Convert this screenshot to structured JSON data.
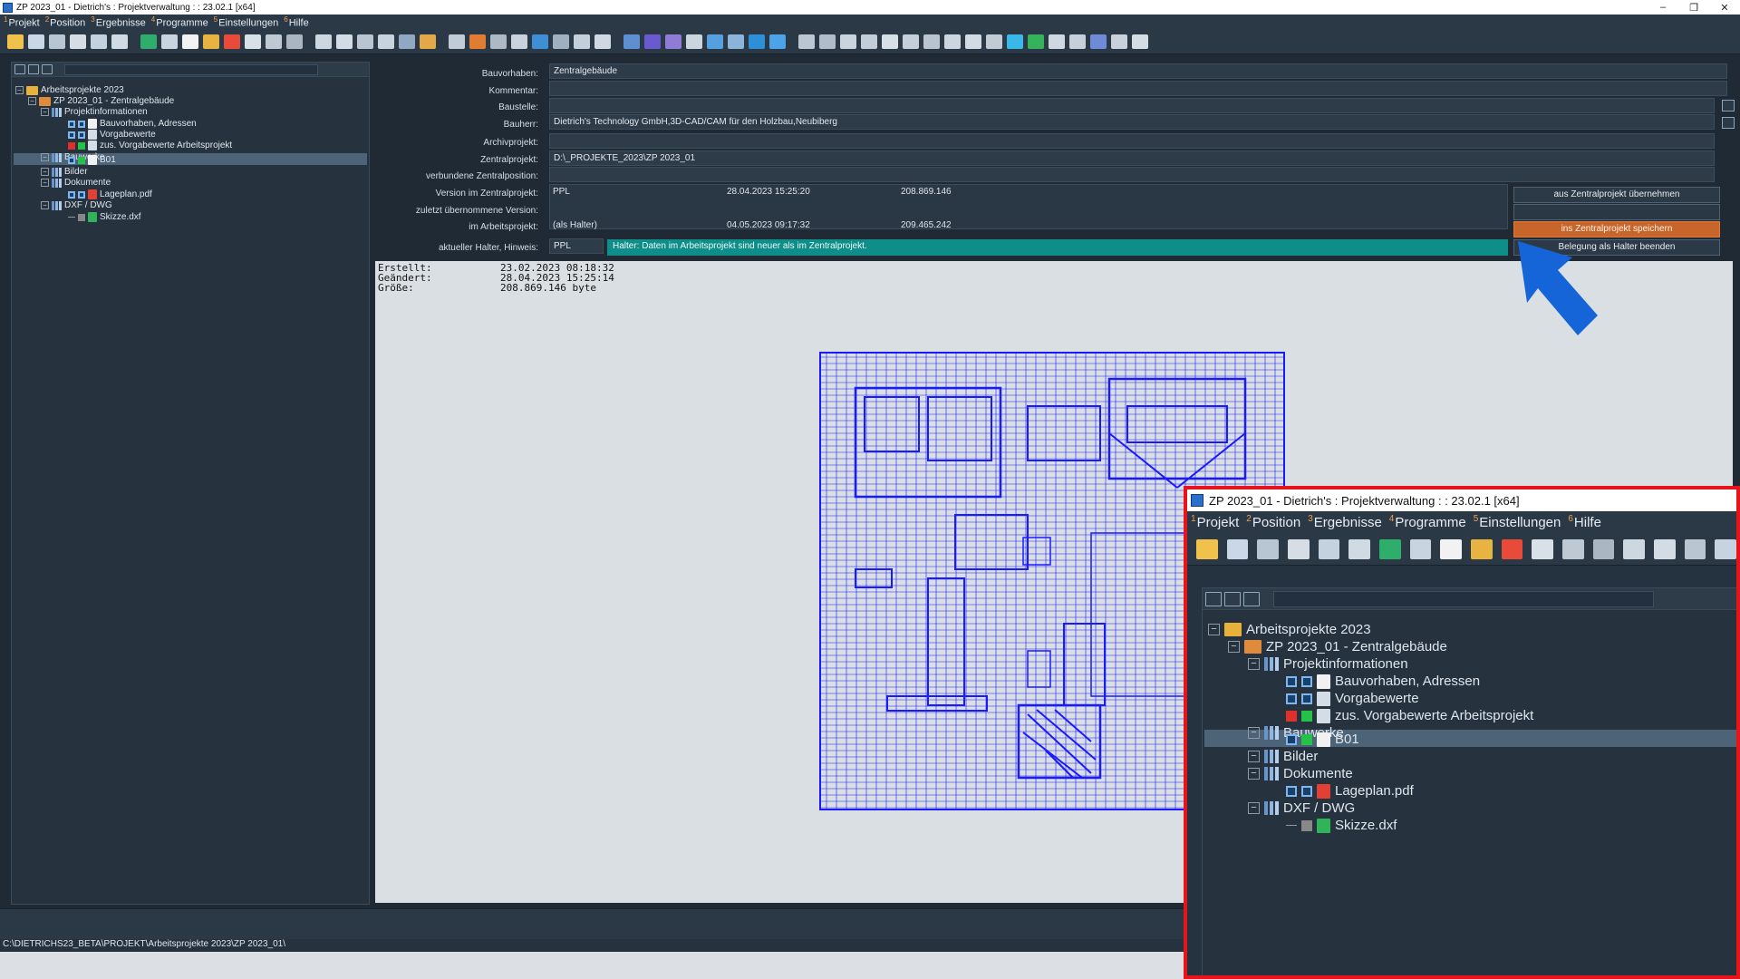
{
  "window": {
    "title": "ZP 2023_01 - Dietrich's : Projektverwaltung : : 23.02.1 [x64]",
    "min": "–",
    "max": "❐",
    "close": "✕"
  },
  "menu": [
    {
      "num": "1",
      "label": "Projekt"
    },
    {
      "num": "2",
      "label": "Position"
    },
    {
      "num": "3",
      "label": "Ergebnisse"
    },
    {
      "num": "4",
      "label": "Programme"
    },
    {
      "num": "5",
      "label": "Einstellungen"
    },
    {
      "num": "6",
      "label": "Hilfe"
    }
  ],
  "toolbar_colors": [
    "#f0c24c",
    "#c9d7e6",
    "#b8c6d4",
    "#d6dde4",
    "#c4d2df",
    "#d0dae3",
    "#2fae6b",
    "#c8d4e0",
    "#f2f2f2",
    "#e7b441",
    "#e84b3a",
    "#d9e1e8",
    "#bfc9d3",
    "#aab6c2",
    "#cdd7e0",
    "#d3dce5",
    "#b9c5d1",
    "#c7d3de",
    "#90a8c2",
    "#e2a84a",
    "#c0ccd8",
    "#e07c34",
    "#adb9c5",
    "#c8d3dd",
    "#3f8fd6",
    "#9fb0c1",
    "#c3cfda",
    "#d0d9e2",
    "#5e8fd0",
    "#6a5ad0",
    "#8e7cd6",
    "#cbd5de",
    "#56a0e0",
    "#8cb3d9",
    "#2f8fd6",
    "#4da3e8",
    "#bbc7d2",
    "#b0bccb",
    "#cad4dd",
    "#c1cdd8",
    "#d7dfe7",
    "#c4cfd9",
    "#b8c4cf",
    "#ccd6df",
    "#d2dbe3",
    "#c0cbd6",
    "#3ab8e8",
    "#36b25c",
    "#cfd8e1",
    "#c6d0da",
    "#6d8bd6",
    "#c9d2db",
    "#d4dce4"
  ],
  "tree": {
    "root": "Arbeitsprojekte 2023",
    "project": "ZP 2023_01 - Zentralgebäude",
    "projektinfo": "Projektinformationen",
    "bauvorhaben": "Bauvorhaben, Adressen",
    "vorgabewerte": "Vorgabewerte",
    "zus_vorgabewerte": "zus. Vorgabewerte Arbeitsprojekt",
    "bauwerke": "Bauwerke",
    "b01": "B01",
    "bilder": "Bilder",
    "dokumente": "Dokumente",
    "lageplan": "Lageplan.pdf",
    "dxf_dwg": "DXF / DWG",
    "skizze": "Skizze.dxf"
  },
  "form": {
    "labels": {
      "bauvorhaben": "Bauvorhaben:",
      "kommentar": "Kommentar:",
      "baustelle": "Baustelle:",
      "bauherr": "Bauherr:",
      "archivprojekt": "Archivprojekt:",
      "zentralprojekt": "Zentralprojekt:",
      "verbundene": "verbundene Zentralposition:",
      "version_zp": "Version im Zentralprojekt:",
      "zuletzt": "zuletzt übernommene Version:",
      "im_ap": "im Arbeitsprojekt:",
      "halter": "aktueller Halter, Hinweis:"
    },
    "values": {
      "bauvorhaben": "Zentralgebäude",
      "kommentar": "",
      "baustelle": "",
      "bauherr": "Dietrich's Technology GmbH,3D-CAD/CAM für den Holzbau,Neubiberg",
      "archivprojekt": "",
      "zentralprojekt": "D:\\_PROJEKTE_2023\\ZP 2023_01",
      "verbundene": "",
      "version_user": "PPL",
      "version_date": "28.04.2023 15:25:20",
      "version_size": "208.869.146",
      "im_ap_user": "(als Halter)",
      "im_ap_date": "04.05.2023 09:17:32",
      "im_ap_size": "209.465.242",
      "halter_user": "PPL",
      "hint": "Halter: Daten im Arbeitsprojekt sind neuer als im Zentralprojekt."
    },
    "buttons": {
      "uebernehmen": "aus Zentralprojekt übernehmen",
      "speichern": "ins Zentralprojekt speichern",
      "beenden": "Belegung als Halter beenden"
    }
  },
  "preview": {
    "created_label": "Erstellt:",
    "created": "23.02.2023 08:18:32",
    "changed_label": "Geändert:",
    "changed": "28.04.2023 15:25:14",
    "size_label": "Größe:",
    "size": "208.869.146 byte"
  },
  "path": "C:\\DIETRICHS23_BETA\\PROJEKT\\Arbeitsprojekte 2023\\ZP 2023_01\\",
  "zoom_title": "ZP 2023_01 - Dietrich's : Projektverwaltung : : 23.02.1 [x64]",
  "colors": {
    "accent_orange": "#c7652a",
    "hint_teal": "#0f8d89",
    "drawing_blue": "#1a1aff",
    "zoom_border": "#e8141b",
    "arrow_blue": "#1565d8"
  }
}
